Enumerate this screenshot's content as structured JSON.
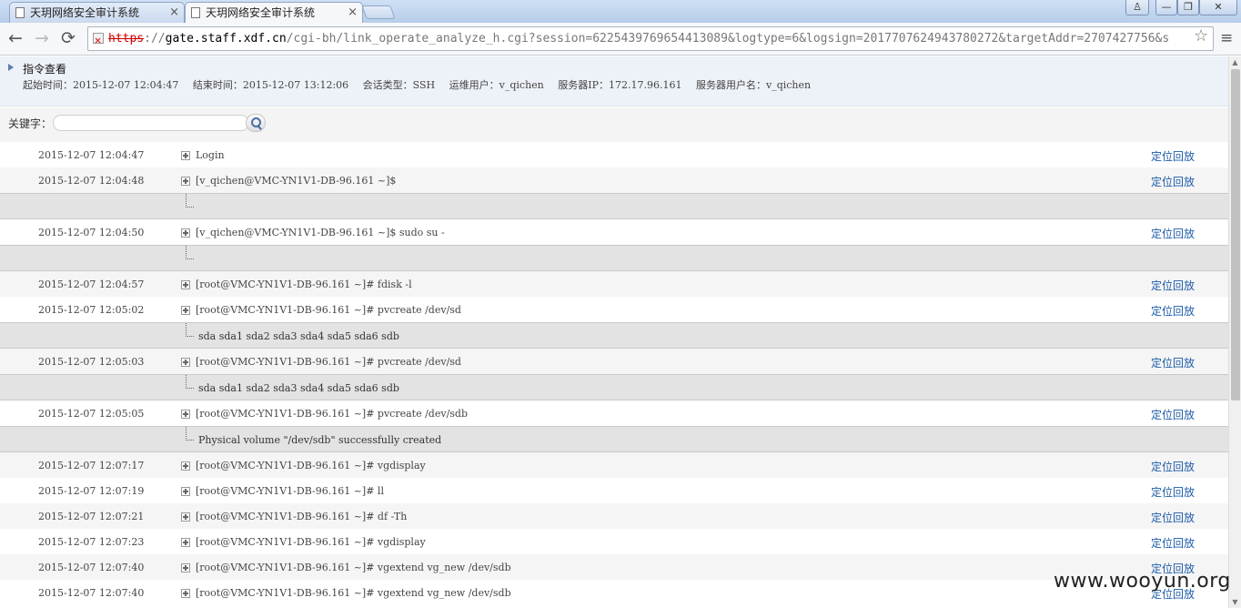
{
  "browser": {
    "tabs": [
      {
        "label": "天玥网络安全审计系统",
        "active": false
      },
      {
        "label": "天玥网络安全审计系统",
        "active": true
      }
    ],
    "tab_close": "×",
    "window_buttons": {
      "user": "♙",
      "minimize": "—",
      "restore": "❐",
      "close": "✕"
    },
    "nav": {
      "back": "←",
      "forward": "→",
      "reload": "⟳"
    },
    "url": {
      "scheme": "https",
      "sep": "://",
      "host": "gate.staff.xdf.cn",
      "path": "/cgi-bh/link_operate_analyze_h.cgi?session=6225439769654413089&logtype=6&logsign=2017707624943780272&targetAddr=2707427756&s"
    },
    "star": "☆",
    "menu": "≡"
  },
  "info": {
    "title": "指令查看",
    "start": "起始时间：2015-12-07 12:04:47",
    "end": "结束时间：2015-12-07 13:12:06",
    "session_type": "会话类型：SSH",
    "ops_user": "运维用户：v_qichen",
    "server_ip": "服务器IP：172.17.96.161",
    "server_user": "服务器用户名：v_qichen"
  },
  "search": {
    "label": "关键字：",
    "value": ""
  },
  "locate_label": "定位回放",
  "rows": [
    {
      "time": "2015-12-07 12:04:47",
      "cmd": "Login"
    },
    {
      "time": "2015-12-07 12:04:48",
      "cmd": "[v_qichen@VMC-YN1V1-DB-96.161 ~]$"
    },
    {
      "output": ""
    },
    {
      "time": "2015-12-07 12:04:50",
      "cmd": "[v_qichen@VMC-YN1V1-DB-96.161 ~]$ sudo su -"
    },
    {
      "output": ""
    },
    {
      "time": "2015-12-07 12:04:57",
      "cmd": "[root@VMC-YN1V1-DB-96.161 ~]# fdisk -l"
    },
    {
      "time": "2015-12-07 12:05:02",
      "cmd": "[root@VMC-YN1V1-DB-96.161 ~]# pvcreate /dev/sd"
    },
    {
      "output": "sda sda1 sda2 sda3 sda4 sda5 sda6 sdb"
    },
    {
      "time": "2015-12-07 12:05:03",
      "cmd": "[root@VMC-YN1V1-DB-96.161 ~]# pvcreate /dev/sd"
    },
    {
      "output": "sda sda1 sda2 sda3 sda4 sda5 sda6 sdb"
    },
    {
      "time": "2015-12-07 12:05:05",
      "cmd": "[root@VMC-YN1V1-DB-96.161 ~]# pvcreate /dev/sdb"
    },
    {
      "output": "Physical volume \"/dev/sdb\" successfully created"
    },
    {
      "time": "2015-12-07 12:07:17",
      "cmd": "[root@VMC-YN1V1-DB-96.161 ~]# vgdisplay"
    },
    {
      "time": "2015-12-07 12:07:19",
      "cmd": "[root@VMC-YN1V1-DB-96.161 ~]# ll"
    },
    {
      "time": "2015-12-07 12:07:21",
      "cmd": "[root@VMC-YN1V1-DB-96.161 ~]# df -Th"
    },
    {
      "time": "2015-12-07 12:07:23",
      "cmd": "[root@VMC-YN1V1-DB-96.161 ~]# vgdisplay"
    },
    {
      "time": "2015-12-07 12:07:40",
      "cmd": "[root@VMC-YN1V1-DB-96.161 ~]# vgextend vg_new /dev/sdb"
    },
    {
      "time": "2015-12-07 12:07:40",
      "cmd": "[root@VMC-YN1V1-DB-96.161 ~]# vgextend vg_new /dev/sdb"
    }
  ],
  "watermark": "www.wooyun.org"
}
